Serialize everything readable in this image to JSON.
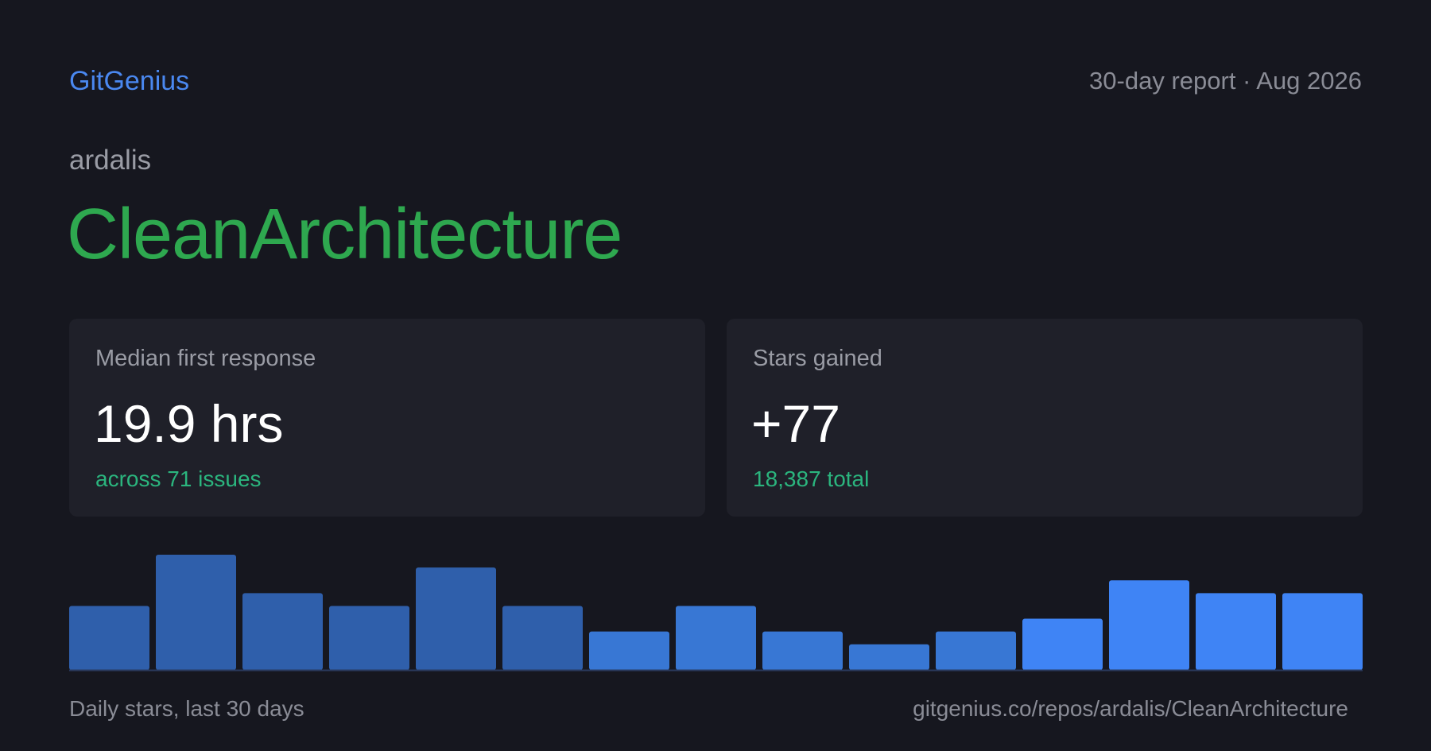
{
  "header": {
    "brand": "GitGenius",
    "report_label": "30-day report · Aug 2026"
  },
  "repo": {
    "owner": "ardalis",
    "name": "CleanArchitecture"
  },
  "cards": {
    "response": {
      "label": "Median first response",
      "value": "19.9 hrs",
      "sub": "across 71 issues"
    },
    "stars": {
      "label": "Stars gained",
      "value": "+77",
      "sub": "18,387 total"
    }
  },
  "footer": {
    "chart_caption": "Daily stars, last 30 days",
    "url": "gitgenius.co/repos/ardalis/CleanArchitecture"
  },
  "colors": {
    "background": "#16171f",
    "card": "#1f2029",
    "brand": "#4a88f0",
    "repo_name": "#2ea84f",
    "sub_text": "#2bb57e",
    "bar_dark": "#2f5fab",
    "bar_mid": "#3877d4",
    "bar_bright": "#3f84f5"
  },
  "chart_data": {
    "type": "bar",
    "values": [
      5,
      9,
      6,
      5,
      8,
      5,
      3,
      5,
      3,
      2,
      3,
      4,
      7,
      6,
      6
    ],
    "ylim": [
      0,
      9
    ],
    "bar_colors": [
      "#2f5fab",
      "#2f5fab",
      "#2f5fab",
      "#2f5fab",
      "#2f5fab",
      "#2f5fab",
      "#3877d4",
      "#3877d4",
      "#3877d4",
      "#3877d4",
      "#3877d4",
      "#3f84f5",
      "#3f84f5",
      "#3f84f5",
      "#3f84f5"
    ],
    "grid": false,
    "legend": "none"
  }
}
